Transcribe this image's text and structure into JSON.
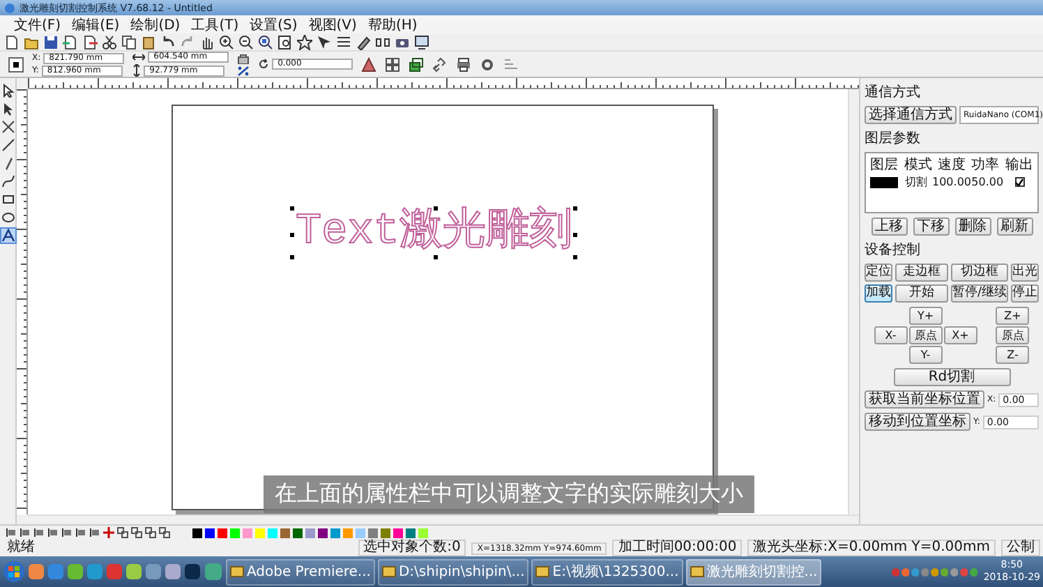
{
  "window": {
    "title": "激光雕刻切割控制系统 V7.68.12 - Untitled"
  },
  "menu": [
    "文件(F)",
    "编辑(E)",
    "绘制(D)",
    "工具(T)",
    "设置(S)",
    "视图(V)",
    "帮助(H)"
  ],
  "properties": {
    "x": {
      "label": "X:",
      "value": "821.790 mm"
    },
    "y": {
      "label": "Y:",
      "value": "812.960 mm"
    },
    "width": "604.540 mm",
    "height": "92.779 mm",
    "rotation": "0.000"
  },
  "canvas": {
    "text": "Text激光雕刻",
    "selected": true,
    "caption": "在上面的属性栏中可以调整文字的实际雕刻大小"
  },
  "panel": {
    "comm_title": "通信方式",
    "comm_button": "选择通信方式",
    "port": "RuidaNano (COM1)",
    "layer_title": "图层参数",
    "layer_columns": [
      "图层",
      "模式",
      "速度",
      "功率",
      "输出"
    ],
    "layers": [
      {
        "color": "#000000",
        "mode": "切割",
        "speed": "100.00",
        "power": "50.00",
        "output": true
      }
    ],
    "layer_buttons": [
      "上移",
      "下移",
      "删除",
      "刷新"
    ],
    "device_title": "设备控制",
    "device_buttons": [
      {
        "label": "定位",
        "focused": false
      },
      {
        "label": "走边框",
        "focused": false
      },
      {
        "label": "切边框",
        "focused": false
      },
      {
        "label": "出光",
        "focused": false
      },
      {
        "label": "加载",
        "focused": true
      },
      {
        "label": "开始",
        "focused": false
      },
      {
        "label": "暂停/继续",
        "focused": false
      },
      {
        "label": "停止",
        "focused": false
      }
    ],
    "jog_xy": {
      "up": "Y+",
      "left": "X-",
      "center": "原点",
      "right": "X+",
      "down": "Y-"
    },
    "jog_z": {
      "up": "Z+",
      "center": "原点",
      "down": "Z-"
    },
    "cut_button": "Rd切割",
    "coord_rows": [
      {
        "button": "获取当前坐标位置",
        "label": "X:",
        "value": "0.00"
      },
      {
        "button": "移动到位置坐标",
        "label": "Y:",
        "value": "0.00"
      }
    ]
  },
  "palette": [
    {
      "color": "#000000"
    },
    {
      "color": "#0000ff"
    },
    {
      "color": "#ff0000"
    },
    {
      "color": "#00ff00"
    },
    {
      "color": "#ff99cc"
    },
    {
      "color": "#ffff00"
    },
    {
      "color": "#00ffff"
    },
    {
      "color": "#996633"
    },
    {
      "color": "#006600"
    },
    {
      "color": "#9999cc"
    },
    {
      "color": "#800080"
    },
    {
      "color": "#0099cc"
    },
    {
      "color": "#ff9900"
    },
    {
      "color": "#99ccff"
    },
    {
      "color": "#808080"
    },
    {
      "color": "#808000"
    },
    {
      "color": "#ff0099"
    },
    {
      "color": "#008080"
    },
    {
      "color": "#99ff33"
    }
  ],
  "status_bar": [
    "就绪",
    "选中对象个数:0",
    "X=1318.32mm Y=974.60mm",
    "加工时间00:00:00",
    "激光头坐标:X=0.00mm Y=0.00mm",
    "公制"
  ],
  "taskbar": {
    "items": [
      {
        "kind": "icon",
        "active": false
      },
      {
        "kind": "task",
        "label": "Adobe Premiere...",
        "active": false
      },
      {
        "kind": "task",
        "label": "D:\\shipin\\shipin\\...",
        "active": false
      },
      {
        "kind": "task",
        "label": "E:\\视频\\1325300...",
        "active": false
      },
      {
        "kind": "task",
        "label": "激光雕刻切割控...",
        "active": true
      }
    ],
    "time": "8:50",
    "date": "2018-10-29"
  }
}
